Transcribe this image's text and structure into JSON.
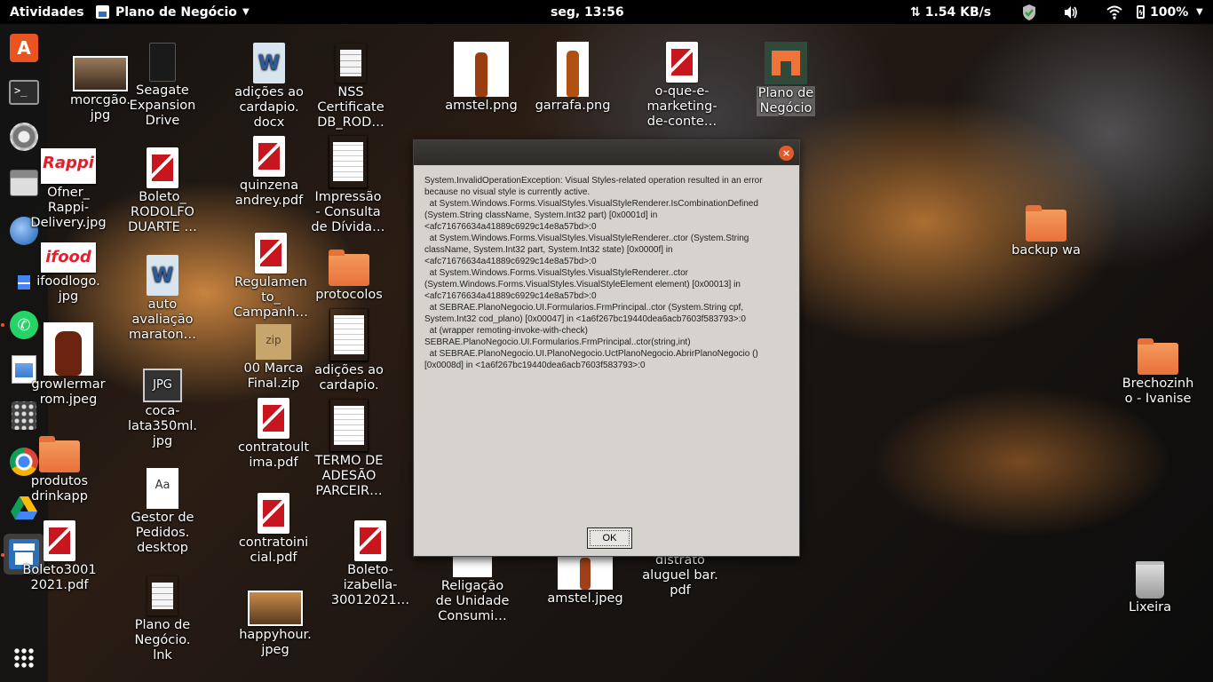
{
  "topbar": {
    "activities": "Atividades",
    "app_name": "Plano de Negócio",
    "clock": "seg, 13:56",
    "net_speed": "1.54 KB/s",
    "battery": "100%"
  },
  "dock": {
    "items": [
      "ubuntu-software",
      "terminal",
      "settings",
      "file-manager",
      "thunderbird",
      "google-docs",
      "whatsapp",
      "image-viewer",
      "calculator",
      "chrome",
      "google-drive",
      "plano-de-negocio-app",
      "show-apps"
    ],
    "active": "plano-de-negocio-app",
    "accent": "#e95420"
  },
  "desktop": {
    "icons": [
      {
        "label": "morcgão.\njpg"
      },
      {
        "label": "Seagate\nExpansion\nDrive"
      },
      {
        "label": "adições ao\ncardapio.\ndocx"
      },
      {
        "label": "NSS\nCertificate\nDB_ROD…"
      },
      {
        "label": "amstel.png"
      },
      {
        "label": "garrafa.png"
      },
      {
        "label": "o-que-e-\nmarketing-\nde-conte…"
      },
      {
        "label": "Plano de\nNegócio"
      },
      {
        "label": "Ofner_\nRappi-\nDelivery.jpg"
      },
      {
        "label": "Boleto_\nRODOLFO\nDUARTE …"
      },
      {
        "label": "quinzena\nandrey.pdf"
      },
      {
        "label": "Impressão\n- Consulta\nde Dívida…"
      },
      {
        "label": "ifoodlogo.\njpg"
      },
      {
        "label": "Regulamen\nto_\nCampanh…"
      },
      {
        "label": "protocolos"
      },
      {
        "label": "auto\navaliação\nmaraton…"
      },
      {
        "label": "growlermar\nrom.jpeg"
      },
      {
        "label": "coca-\nlata350ml.\njpg"
      },
      {
        "label": "00 Marca\nFinal.zip"
      },
      {
        "label": "adições ao\ncardapio."
      },
      {
        "label": "contratoult\nima.pdf"
      },
      {
        "label": "TERMO DE\nADESÃO\nPARCEIR…"
      },
      {
        "label": "produtos\ndrinkapp"
      },
      {
        "label": "Gestor de\nPedidos.\ndesktop"
      },
      {
        "label": "contratoini\ncial.pdf"
      },
      {
        "label": "Boleto-\nizabella-\n30012021…"
      },
      {
        "label": "Boleto3001\n2021.pdf"
      },
      {
        "label": "Religação\nde Unidade\nConsumi…"
      },
      {
        "label": "amstel.jpeg"
      },
      {
        "label": "distrato\naluguel bar.\npdf"
      },
      {
        "label": "Plano de\nNegócio.\nlnk"
      },
      {
        "label": "happyhour.\njpeg"
      },
      {
        "label": "backup wa"
      },
      {
        "label": "Brechozinh\no - Ivanise"
      },
      {
        "label": "Lixeira"
      }
    ],
    "partial_labels": [
      "ech",
      "e…",
      "de+",
      "s.",
      "p",
      "s",
      "es.",
      "nte",
      "anh",
      "V…"
    ]
  },
  "dialog": {
    "close_label": "×",
    "message": "System.InvalidOperationException: Visual Styles-related operation resulted in an error because no visual style is currently active.\n  at System.Windows.Forms.VisualStyles.VisualStyleRenderer.IsCombinationDefined (System.String className, System.Int32 part) [0x0001d] in <afc71676634a41889c6929c14e8a57bd>:0\n  at System.Windows.Forms.VisualStyles.VisualStyleRenderer..ctor (System.String className, System.Int32 part, System.Int32 state) [0x0000f] in <afc71676634a41889c6929c14e8a57bd>:0\n  at System.Windows.Forms.VisualStyles.VisualStyleRenderer..ctor (System.Windows.Forms.VisualStyles.VisualStyleElement element) [0x00013] in <afc71676634a41889c6929c14e8a57bd>:0\n  at SEBRAE.PlanoNegocio.UI.Formularios.FrmPrincipal..ctor (System.String cpf, System.Int32 cod_plano) [0x00047] in <1a6f267bc19440dea6acb7603f583793>:0\n  at (wrapper remoting-invoke-with-check) SEBRAE.PlanoNegocio.UI.Formularios.FrmPrincipal..ctor(string,int)\n  at SEBRAE.PlanoNegocio.UI.PlanoNegocio.UctPlanoNegocio.AbrirPlanoNegocio () [0x0008d] in <1a6f267bc19440dea6acb7603f583793>:0",
    "ok_label": "OK"
  }
}
